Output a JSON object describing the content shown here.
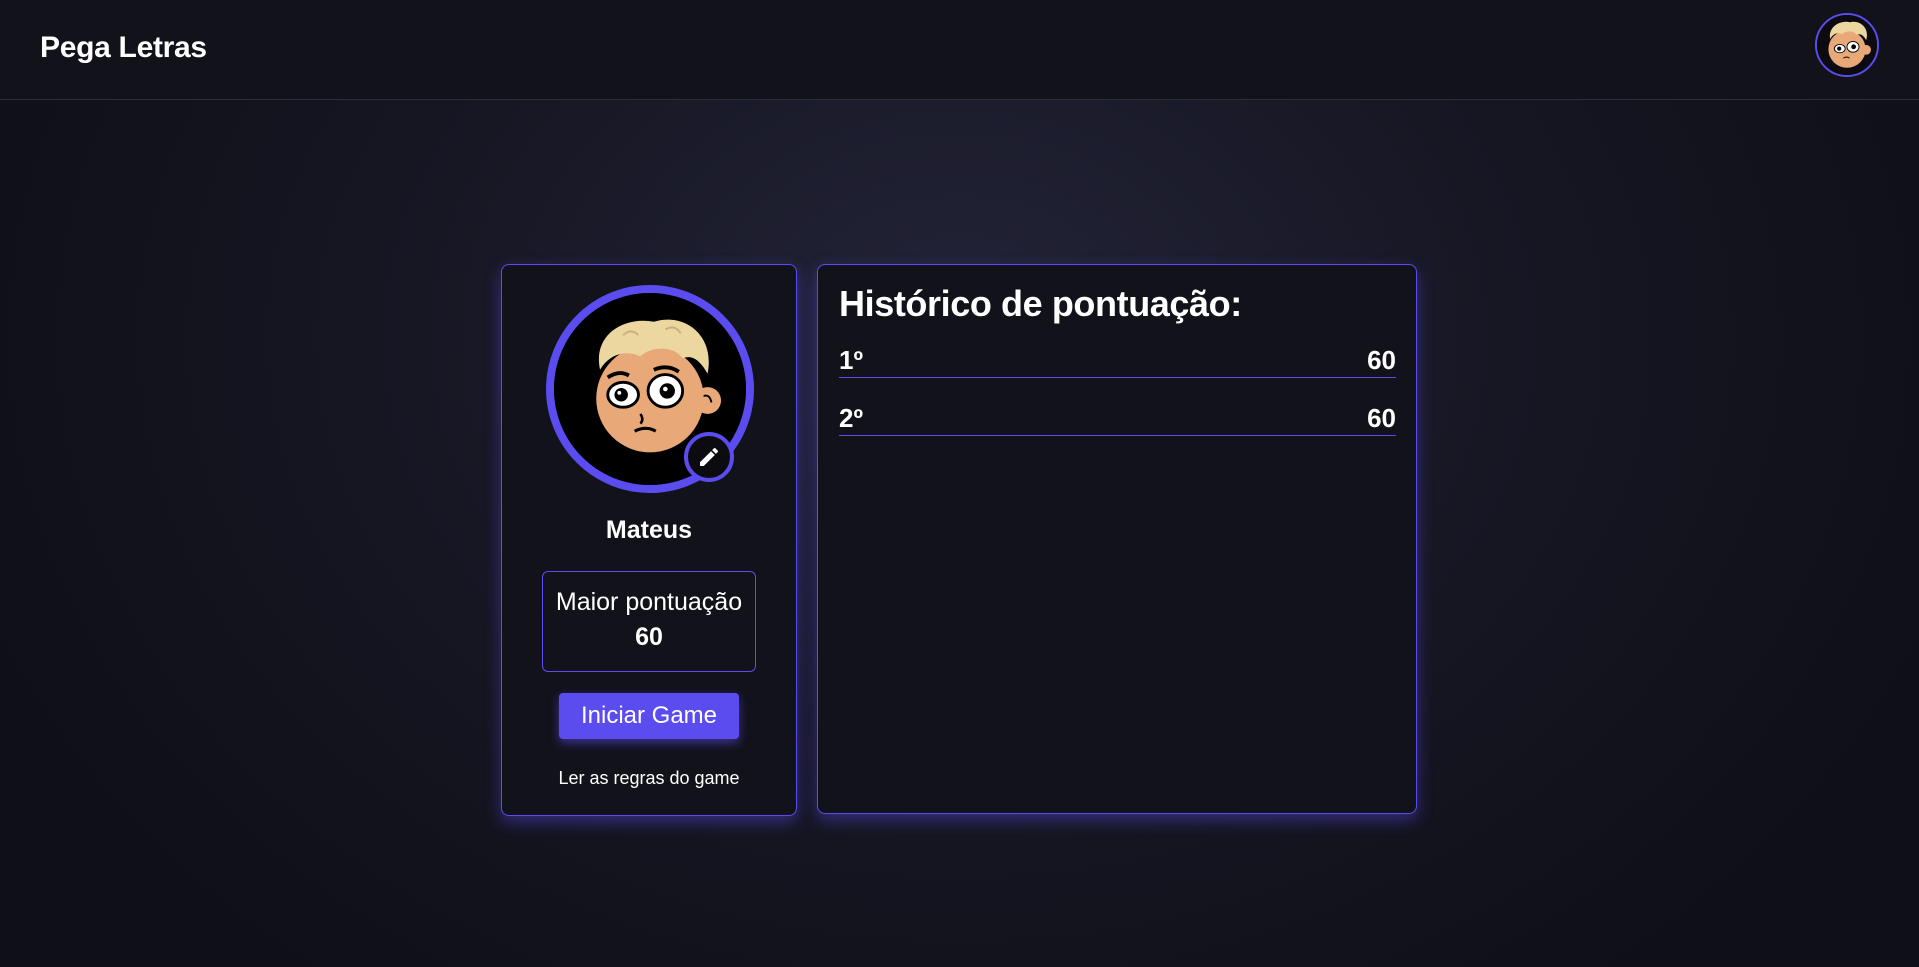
{
  "header": {
    "title": "Pega Letras",
    "avatar_icon": "cartoon-avatar-icon"
  },
  "profile": {
    "username": "Mateus",
    "avatar_icon": "cartoon-avatar-icon",
    "edit_icon": "pencil-icon",
    "best_score_label": "Maior pontuação",
    "best_score_value": "60",
    "start_button": "Iniciar Game",
    "rules_link": "Ler as regras do game"
  },
  "history": {
    "title": "Histórico de pontuação:",
    "rows": [
      {
        "rank": "1º",
        "score": "60"
      },
      {
        "rank": "2º",
        "score": "60"
      }
    ]
  },
  "colors": {
    "accent": "#5b4cf0",
    "card_bg": "#12121b",
    "page_bg": "#181826"
  }
}
